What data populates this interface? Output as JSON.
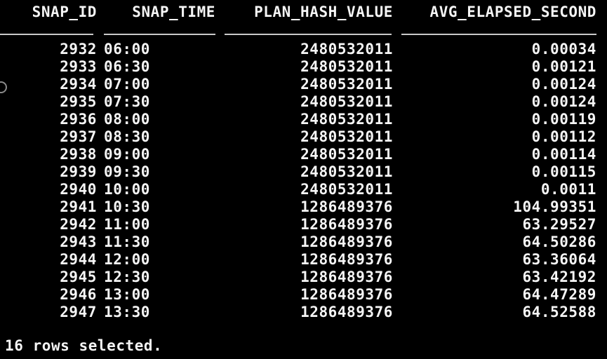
{
  "terminal": {
    "colors": {
      "background": "#000000",
      "text": "#f5f5f5",
      "underline": "#c9c9c9"
    },
    "columns": [
      {
        "label": "SNAP_ID"
      },
      {
        "label": "SNAP_TIME"
      },
      {
        "label": "PLAN_HASH_VALUE"
      },
      {
        "label": "AVG_ELAPSED_SECOND"
      }
    ],
    "rows": [
      {
        "snap_id": "2932",
        "snap_time": "06:00",
        "plan_hash_value": "2480532011",
        "avg_elapsed_second": "0.00034"
      },
      {
        "snap_id": "2933",
        "snap_time": "06:30",
        "plan_hash_value": "2480532011",
        "avg_elapsed_second": "0.00121"
      },
      {
        "snap_id": "2934",
        "snap_time": "07:00",
        "plan_hash_value": "2480532011",
        "avg_elapsed_second": "0.00124"
      },
      {
        "snap_id": "2935",
        "snap_time": "07:30",
        "plan_hash_value": "2480532011",
        "avg_elapsed_second": "0.00124"
      },
      {
        "snap_id": "2936",
        "snap_time": "08:00",
        "plan_hash_value": "2480532011",
        "avg_elapsed_second": "0.00119"
      },
      {
        "snap_id": "2937",
        "snap_time": "08:30",
        "plan_hash_value": "2480532011",
        "avg_elapsed_second": "0.00112"
      },
      {
        "snap_id": "2938",
        "snap_time": "09:00",
        "plan_hash_value": "2480532011",
        "avg_elapsed_second": "0.00114"
      },
      {
        "snap_id": "2939",
        "snap_time": "09:30",
        "plan_hash_value": "2480532011",
        "avg_elapsed_second": "0.00115"
      },
      {
        "snap_id": "2940",
        "snap_time": "10:00",
        "plan_hash_value": "2480532011",
        "avg_elapsed_second": "0.0011"
      },
      {
        "snap_id": "2941",
        "snap_time": "10:30",
        "plan_hash_value": "1286489376",
        "avg_elapsed_second": "104.99351"
      },
      {
        "snap_id": "2942",
        "snap_time": "11:00",
        "plan_hash_value": "1286489376",
        "avg_elapsed_second": "63.29527"
      },
      {
        "snap_id": "2943",
        "snap_time": "11:30",
        "plan_hash_value": "1286489376",
        "avg_elapsed_second": "64.50286"
      },
      {
        "snap_id": "2944",
        "snap_time": "12:00",
        "plan_hash_value": "1286489376",
        "avg_elapsed_second": "63.36064"
      },
      {
        "snap_id": "2945",
        "snap_time": "12:30",
        "plan_hash_value": "1286489376",
        "avg_elapsed_second": "63.42192"
      },
      {
        "snap_id": "2946",
        "snap_time": "13:00",
        "plan_hash_value": "1286489376",
        "avg_elapsed_second": "64.47289"
      },
      {
        "snap_id": "2947",
        "snap_time": "13:30",
        "plan_hash_value": "1286489376",
        "avg_elapsed_second": "64.52588"
      }
    ],
    "footer": "16 rows selected."
  }
}
